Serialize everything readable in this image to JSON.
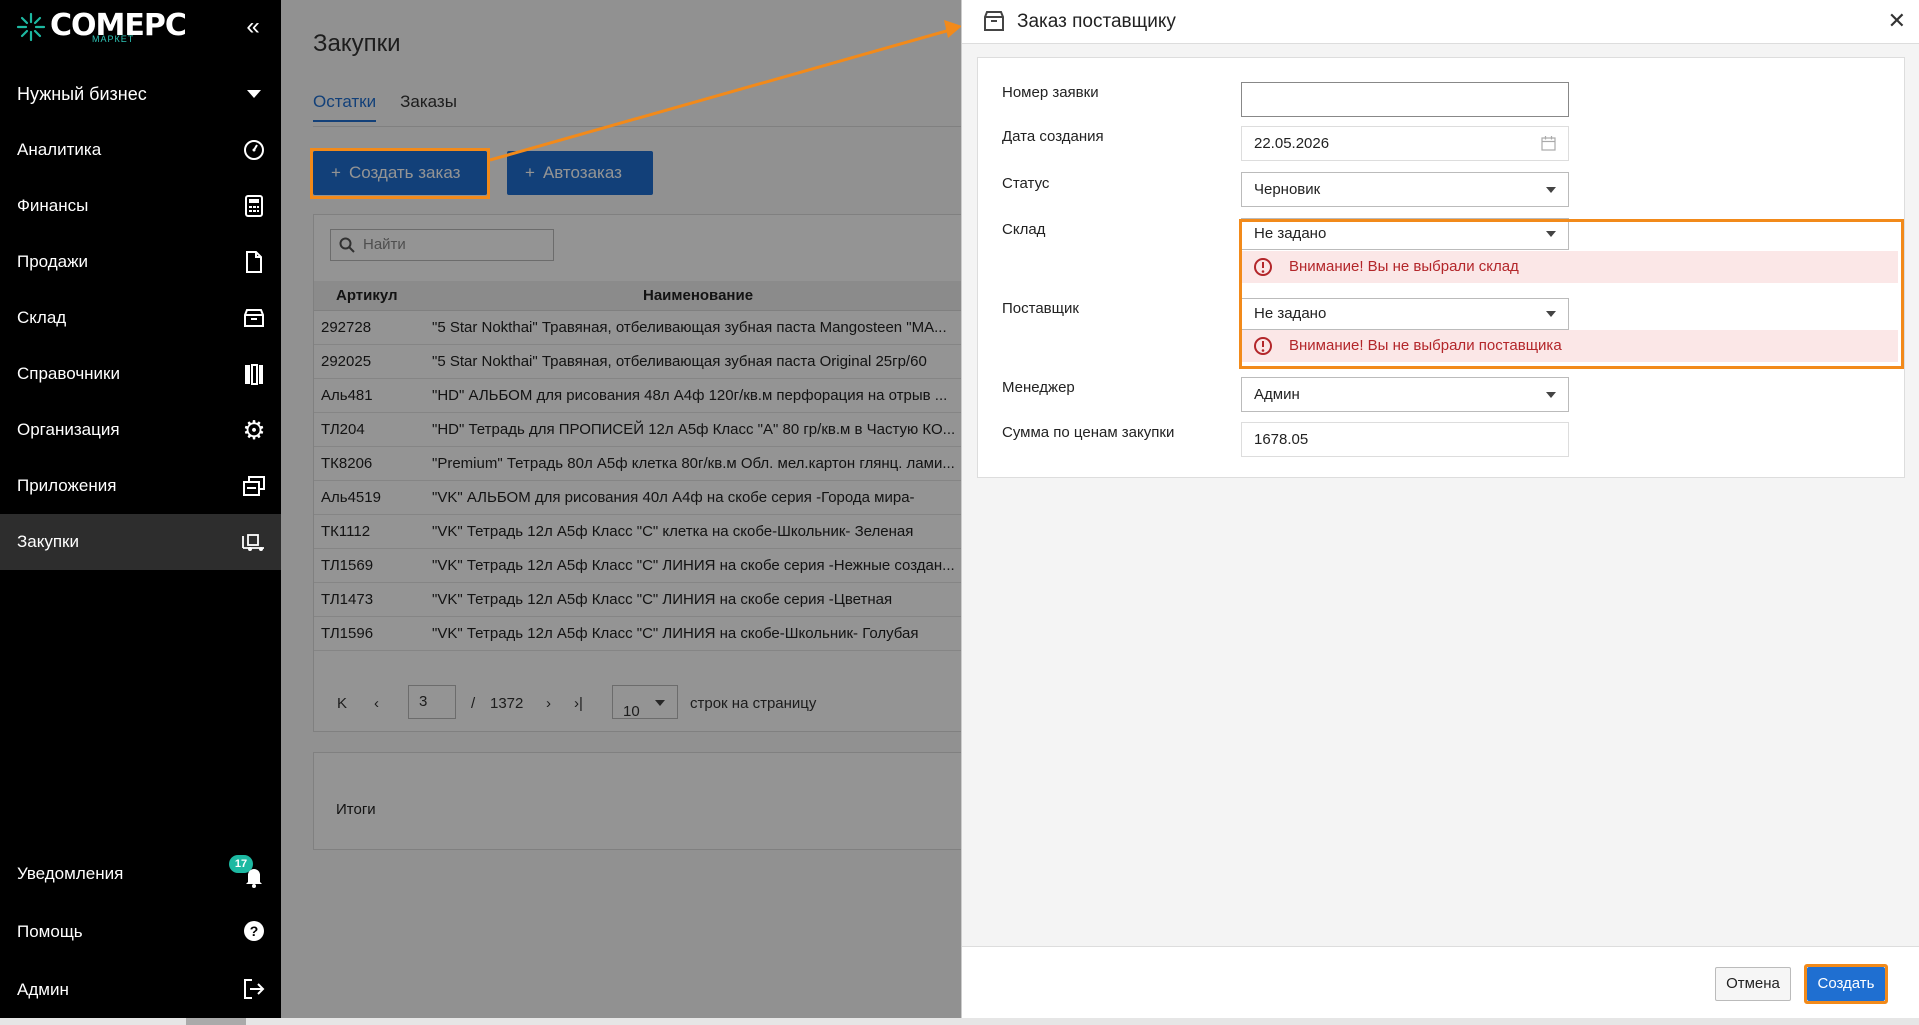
{
  "brand": {
    "name": "COMEPC",
    "sub": "МАРКЕТ",
    "accent": "#1db9a2"
  },
  "sidebar": {
    "business": "Нужный бизнес",
    "items": [
      {
        "label": "Аналитика",
        "icon": "speedometer-icon"
      },
      {
        "label": "Финансы",
        "icon": "calculator-icon"
      },
      {
        "label": "Продажи",
        "icon": "document-icon"
      },
      {
        "label": "Склад",
        "icon": "box-icon"
      },
      {
        "label": "Справочники",
        "icon": "books-icon"
      },
      {
        "label": "Организация",
        "icon": "gear-icon"
      },
      {
        "label": "Приложения",
        "icon": "windows-icon"
      },
      {
        "label": "Закупки",
        "icon": "truck-icon",
        "active": true
      }
    ],
    "bottom": [
      {
        "label": "Уведомления",
        "icon": "bell-icon",
        "badge": "17"
      },
      {
        "label": "Помощь",
        "icon": "help-icon"
      },
      {
        "label": "Админ",
        "icon": "logout-icon"
      }
    ]
  },
  "main": {
    "title": "Закупки",
    "tabs": [
      "Остатки",
      "Заказы"
    ],
    "create_order": "Создать заказ",
    "auto_order": "Автозаказ",
    "search_placeholder": "Найти",
    "columns": [
      "Артикул",
      "Наименование"
    ],
    "rows": [
      [
        "292728",
        "\"5 Star Nokthai\" Травяная, отбеливающая зубная паста Mangosteen \"МА..."
      ],
      [
        "292025",
        "\"5 Star Nokthai\" Травяная, отбеливающая зубная паста Original 25гр/60"
      ],
      [
        "Аль481",
        "\"HD\" АЛЬБОМ для рисования 48л А4ф 120г/кв.м перфорация на отрыв ..."
      ],
      [
        "ТЛ204",
        "\"HD\" Тетрадь для ПРОПИСЕЙ 12л А5ф Класс \"А\" 80 гр/кв.м в Частую КО..."
      ],
      [
        "ТК8206",
        "\"Premium\" Тетрадь 80л А5ф клетка 80г/кв.м Обл. мел.картон глянц. лами..."
      ],
      [
        "Аль4519",
        "\"VK\" АЛЬБОМ для рисования 40л А4ф на скобе серия -Города мира-"
      ],
      [
        "ТК1112",
        "\"VK\" Тетрадь 12л А5ф Класс \"С\" клетка на скобе-Школьник- Зеленая"
      ],
      [
        "ТЛ1569",
        "\"VK\" Тетрадь 12л А5ф Класс \"С\" ЛИНИЯ на скобе серия -Нежные создан..."
      ],
      [
        "ТЛ1473",
        "\"VK\" Тетрадь 12л А5ф Класс \"С\" ЛИНИЯ на скобе серия -Цветная"
      ],
      [
        "ТЛ1596",
        "\"VK\" Тетрадь 12л А5ф Класс \"С\" ЛИНИЯ на скобе-Школьник- Голубая"
      ]
    ],
    "pager": {
      "page": "3",
      "sep": "/",
      "total": "1372",
      "per_page": "10",
      "per_page_label": "строк на страницу"
    },
    "totals_label": "Итоги"
  },
  "dialog": {
    "title": "Заказ поставщику",
    "fields": {
      "order_number": {
        "label": "Номер заявки",
        "value": ""
      },
      "created": {
        "label": "Дата создания",
        "value": "22.05.2026"
      },
      "status": {
        "label": "Статус",
        "value": "Черновик"
      },
      "warehouse": {
        "label": "Склад",
        "value": "Не задано",
        "error": "Внимание! Вы не выбрали склад"
      },
      "supplier": {
        "label": "Поставщик",
        "value": "Не задано",
        "error": "Внимание! Вы не выбрали поставщика"
      },
      "manager": {
        "label": "Менеджер",
        "value": "Админ"
      },
      "sum": {
        "label": "Сумма по ценам закупки",
        "value": "1678.05"
      }
    },
    "cancel": "Отмена",
    "create": "Создать"
  }
}
